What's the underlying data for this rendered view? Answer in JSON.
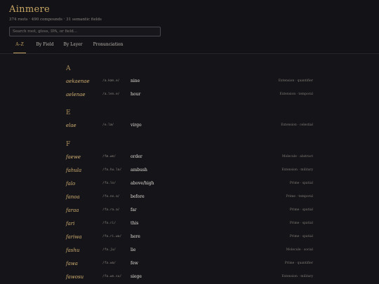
{
  "app": {
    "title": "Ainmere",
    "stats": "374 roots · 490 compounds · 31 semantic fields"
  },
  "search": {
    "placeholder": "Search root, gloss, IPA, or field..."
  },
  "tabs": [
    {
      "label": "A–Z",
      "active": true
    },
    {
      "label": "By Field",
      "active": false
    },
    {
      "label": "By Layer",
      "active": false
    },
    {
      "label": "Pronunciation",
      "active": false
    }
  ],
  "groups": [
    {
      "letter": "A",
      "entries": [
        {
          "root": "aekaenae",
          "ipa": "/a.kæn.e/",
          "gloss": "nine",
          "field": "Extension · quantifier"
        },
        {
          "root": "aelenae",
          "ipa": "/a.len.e/",
          "gloss": "hour",
          "field": "Extension · temporal"
        }
      ]
    },
    {
      "letter": "E",
      "entries": [
        {
          "root": "elae",
          "ipa": "/e.læ/",
          "gloss": "virgo",
          "field": "Extension · celestial"
        }
      ]
    },
    {
      "letter": "F",
      "entries": [
        {
          "root": "faewe",
          "ipa": "/fæ.we/",
          "gloss": "order",
          "field": "Molecule · abstract"
        },
        {
          "root": "fahula",
          "ipa": "/fa.hu.la/",
          "gloss": "ambush",
          "field": "Extension · military"
        },
        {
          "root": "falo",
          "ipa": "/fa.lo/",
          "gloss": "above/high",
          "field": "Prime · spatial"
        },
        {
          "root": "fanoa",
          "ipa": "/fa.no.a/",
          "gloss": "before",
          "field": "Prime · temporal"
        },
        {
          "root": "faraa",
          "ipa": "/fa.ra.a/",
          "gloss": "far",
          "field": "Prime · spatial"
        },
        {
          "root": "fari",
          "ipa": "/fa.ri/",
          "gloss": "this",
          "field": "Prime · spatial"
        },
        {
          "root": "fariwa",
          "ipa": "/fa.ri.wa/",
          "gloss": "here",
          "field": "Prime · spatial"
        },
        {
          "root": "fashu",
          "ipa": "/fa.ʃu/",
          "gloss": "lie",
          "field": "Molecule · social"
        },
        {
          "root": "fawa",
          "ipa": "/fa.wa/",
          "gloss": "few",
          "field": "Prime · quantifier"
        },
        {
          "root": "fawosu",
          "ipa": "/fa.wo.su/",
          "gloss": "siege",
          "field": "Extension · military"
        }
      ]
    }
  ],
  "colors": {
    "accent": "#c9a765",
    "background": "#151419",
    "text": "#d8d4cc"
  }
}
